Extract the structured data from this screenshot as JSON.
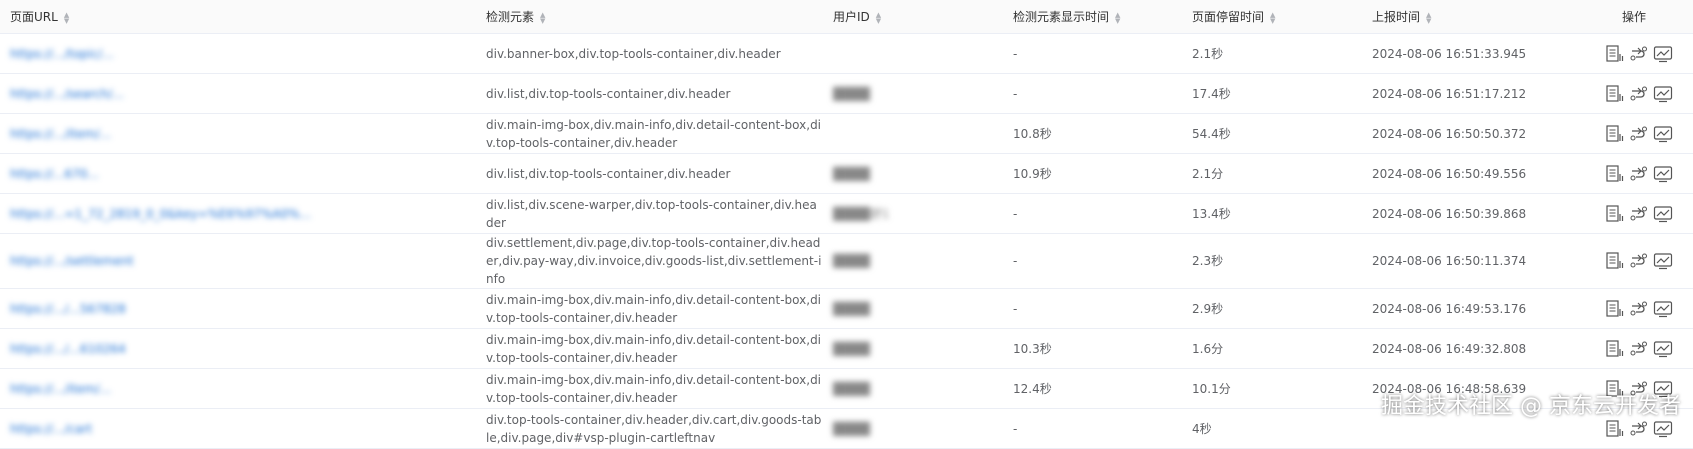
{
  "columns": {
    "url": "页面URL",
    "elements": "检测元素",
    "user_id": "用户ID",
    "display_time": "检测元素显示时间",
    "stay_time": "页面停留时间",
    "report_time": "上报时间",
    "actions": "操作"
  },
  "rows": [
    {
      "url": "https://.../topic/...",
      "elements": "div.banner-box,div.top-tools-container,div.header",
      "user_id": "",
      "display_time": "-",
      "stay_time": "2.1秒",
      "report_time": "2024-08-06 16:51:33.945"
    },
    {
      "url": "https://.../search/...",
      "elements": "div.list,div.top-tools-container,div.header",
      "user_id": "████",
      "display_time": "-",
      "stay_time": "17.4秒",
      "report_time": "2024-08-06 16:51:17.212"
    },
    {
      "url": "https://.../item/...",
      "elements": "div.main-img-box,div.main-info,div.detail-content-box,div.top-tools-container,div.header",
      "user_id": "",
      "display_time": "10.8秒",
      "stay_time": "54.4秒",
      "report_time": "2024-08-06 16:50:50.372"
    },
    {
      "url": "https://...670...",
      "elements": "div.list,div.top-tools-container,div.header",
      "user_id": "████",
      "display_time": "10.9秒",
      "stay_time": "2.1分",
      "report_time": "2024-08-06 16:50:49.556"
    },
    {
      "url": "https://...=1_72_2819_0_0&key=%E6%97%A0%...",
      "elements": "div.list,div.scene-warper,div.top-tools-container,div.header",
      "user_id": "████舒1",
      "display_time": "-",
      "stay_time": "13.4秒",
      "report_time": "2024-08-06 16:50:39.868"
    },
    {
      "url": "https://.../settlement",
      "elements": "div.settlement,div.page,div.top-tools-container,div.header,div.pay-way,div.invoice,div.goods-list,div.settlement-info",
      "user_id": "████",
      "display_time": "-",
      "stay_time": "2.3秒",
      "report_time": "2024-08-06 16:50:11.374"
    },
    {
      "url": "https://.../...567828",
      "elements": "div.main-img-box,div.main-info,div.detail-content-box,div.top-tools-container,div.header",
      "user_id": "████",
      "display_time": "-",
      "stay_time": "2.9秒",
      "report_time": "2024-08-06 16:49:53.176"
    },
    {
      "url": "https://.../...610264",
      "elements": "div.main-img-box,div.main-info,div.detail-content-box,div.top-tools-container,div.header",
      "user_id": "████",
      "display_time": "10.3秒",
      "stay_time": "1.6分",
      "report_time": "2024-08-06 16:49:32.808"
    },
    {
      "url": "https://.../item/...",
      "elements": "div.main-img-box,div.main-info,div.detail-content-box,div.top-tools-container,div.header",
      "user_id": "████",
      "display_time": "12.4秒",
      "stay_time": "10.1分",
      "report_time": "2024-08-06 16:48:58.639"
    },
    {
      "url": "https://.../cart",
      "elements": "div.top-tools-container,div.header,div.cart,div.goods-table,div.page,div#vsp-plugin-cartleftnav",
      "user_id": "████",
      "display_time": "-",
      "stay_time": "4秒",
      "report_time": ""
    }
  ],
  "watermark": "掘金技术社区 @ 京东云开发者",
  "colors": {
    "link": "#1a6fd4",
    "header_bg": "#fafafa",
    "border": "#ebeef5"
  }
}
